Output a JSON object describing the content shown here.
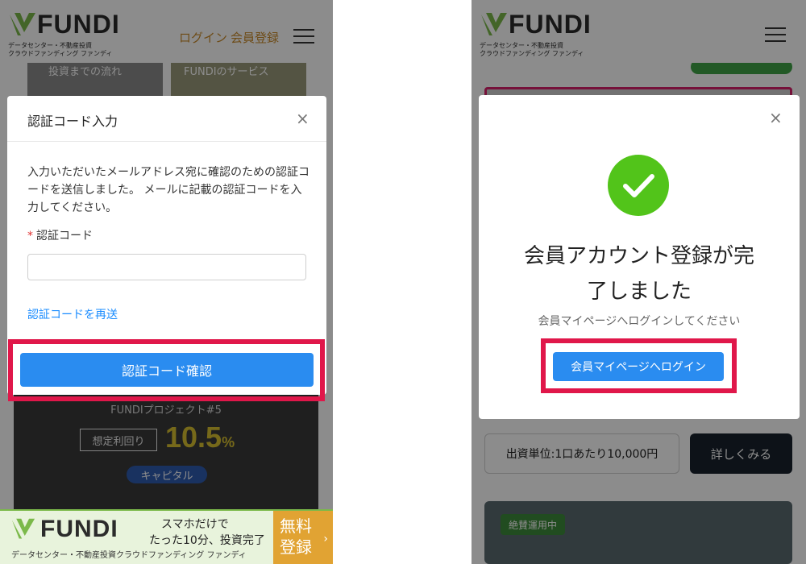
{
  "left": {
    "header": {
      "logo_text": "FUNDI",
      "logo_sub_1": "データセンター・不動産投資",
      "logo_sub_2": "クラウドファンディング ファンディ",
      "login_link": "ログイン",
      "register_link": "会員登録"
    },
    "background": {
      "card1_text": "投資までの流れ",
      "card2_text": "FUNDIのサービス"
    },
    "modal": {
      "title": "認証コード入力",
      "close_icon": "×",
      "message": "入力いただいたメールアドレス宛に確認のための認証コードを送信しました。 メールに記載の認証コードを入力してください。",
      "required_mark": "*",
      "field_label": "認証コード",
      "field_value": "",
      "resend_link": "認証コードを再送",
      "confirm_button": "認証コード確認"
    },
    "promo": {
      "project_title": "FUNDIプロジェクト#5",
      "yield_label": "想定利回り",
      "yield_value": "10.5",
      "yield_unit": "%",
      "capital_badge": "キャピタル"
    },
    "banner": {
      "logo_text": "FUNDI",
      "line1": "スマホだけで",
      "line2": "たった10分、投資完了",
      "sub": "データセンター・不動産投資クラウドファンディング ファンディ",
      "cta_line1": "無料",
      "cta_line2": "登録",
      "cta_chevron": "›"
    }
  },
  "right": {
    "header": {
      "logo_text": "FUNDI",
      "logo_sub_1": "データセンター・不動産投資",
      "logo_sub_2": "クラウドファンディング ファンディ"
    },
    "modal": {
      "close_icon": "×",
      "title_line1": "会員アカウント登録が完",
      "title_line2": "了しました",
      "subtitle": "会員マイページへログインしてください",
      "login_button": "会員マイページへログイン"
    },
    "background": {
      "unit_text": "出資単位:1口あたり10,000円",
      "detail_button": "詳しくみる",
      "status_badge": "絶賛運用中"
    }
  },
  "colors": {
    "primary_blue": "#2a8cf0",
    "highlight_red": "#e0174a",
    "success_green": "#52c41a",
    "brand_green": "#7bb94a",
    "link_orange": "#c98a2b"
  }
}
